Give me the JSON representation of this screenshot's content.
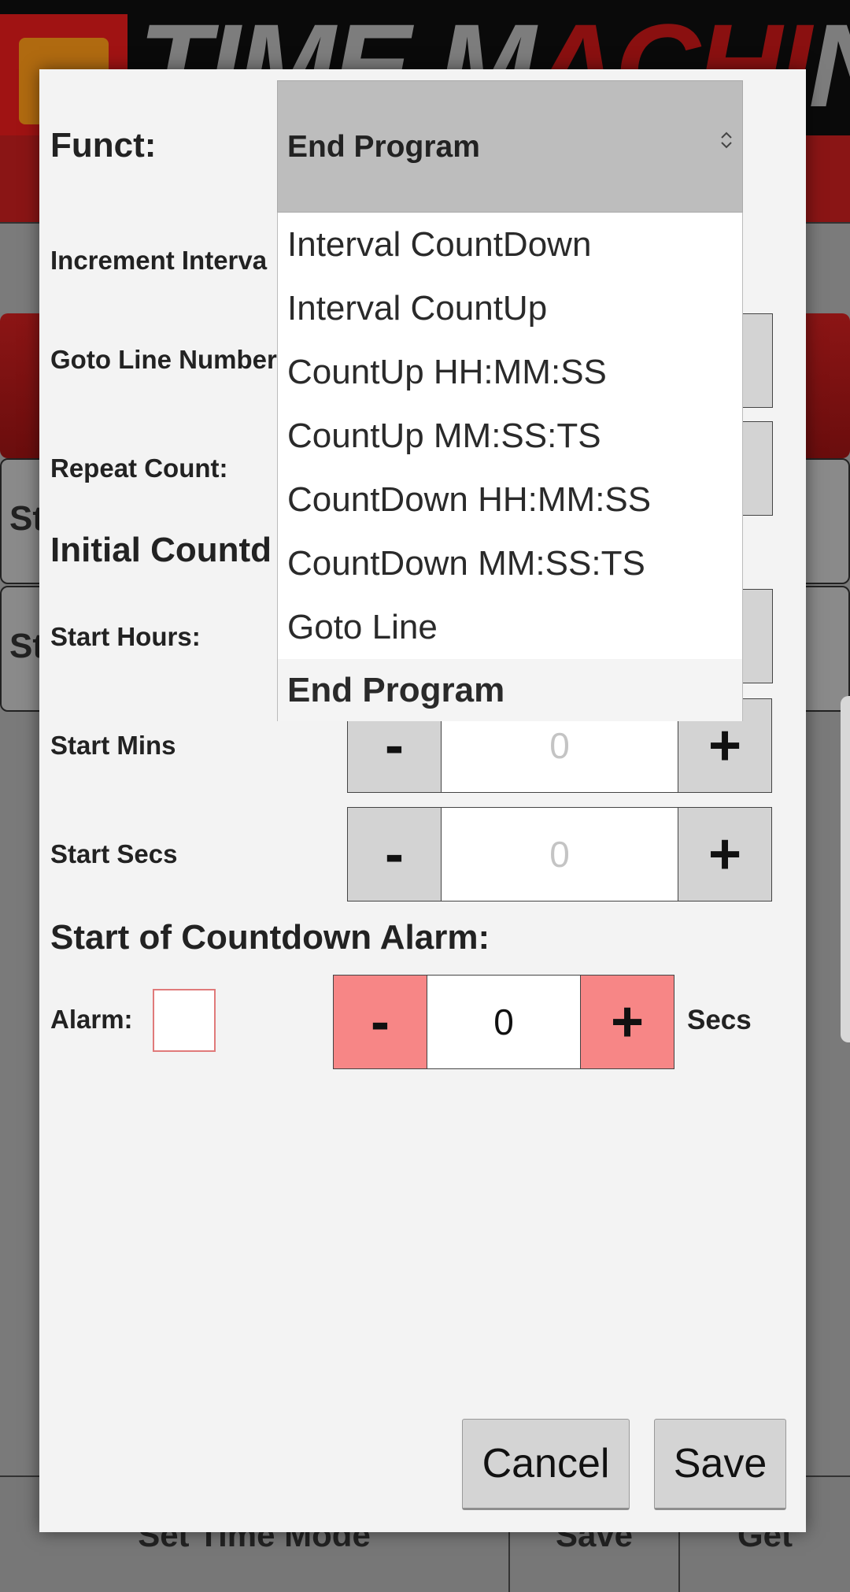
{
  "background": {
    "logo_text_a": "TIME M",
    "logo_text_b": "ACHI",
    "logo_text_c": "NES",
    "row1_text": "St",
    "row2_text": "St",
    "footer": {
      "set_time_mode": "Set Time Mode",
      "save": "Save",
      "get": "Get"
    }
  },
  "dialog": {
    "funct_label": "Funct:",
    "funct_value": "End Program",
    "increment_interval_label": "Increment Interva",
    "goto_line_label": "Goto Line Number",
    "repeat_count_label": "Repeat Count:",
    "initial_countdown_label": "Initial Countd",
    "start_hours_label": "Start Hours:",
    "start_mins_label": "Start Mins",
    "start_mins_value": "0",
    "start_secs_label": "Start Secs",
    "start_secs_value": "0",
    "alarm_section_label": "Start of Countdown Alarm:",
    "alarm_label": "Alarm:",
    "alarm_value": "0",
    "alarm_unit": "Secs",
    "minus": "-",
    "plus": "+",
    "cancel_label": "Cancel",
    "save_label": "Save"
  },
  "dropdown_options": [
    "Interval CountDown",
    "Interval CountUp",
    "CountUp HH:MM:SS",
    "CountUp MM:SS:TS",
    "CountDown HH:MM:SS",
    "CountDown MM:SS:TS",
    "Goto Line",
    "End Program"
  ],
  "icons": {
    "select_chevron": "⌃⌄",
    "back_icon": "arrow-left-icon"
  },
  "colors": {
    "pink_button": "#f78686",
    "brand_red": "#a01313"
  }
}
